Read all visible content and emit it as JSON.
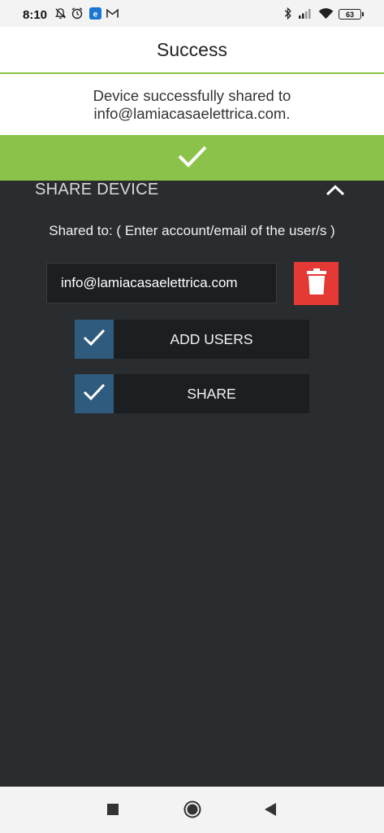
{
  "status_bar": {
    "time": "8:10",
    "battery_level": "63",
    "icons": [
      "bell-off-icon",
      "alarm-icon",
      "app-e-icon",
      "gmail-icon",
      "bluetooth-icon",
      "signal-icon",
      "wifi-icon",
      "battery-icon"
    ]
  },
  "dialog": {
    "title": "Success",
    "message": "Device successfully shared to info@lamiacasaelettrica.com.",
    "ok_icon": "checkmark-icon",
    "accent_color": "#8bc34a"
  },
  "share_section": {
    "title": "SHARE DEVICE",
    "collapse_icon": "chevron-up-icon",
    "shared_to_label": "Shared to: ( Enter account/email of the user/s )",
    "email_value": "info@lamiacasaelettrica.com",
    "delete_icon": "trash-icon",
    "delete_color": "#e53935",
    "add_users_label": "ADD USERS",
    "share_label": "SHARE",
    "check_color": "#2f5b7f"
  },
  "nav_bar": {
    "icons": [
      "recents-square-icon",
      "home-circle-icon",
      "back-triangle-icon"
    ]
  }
}
